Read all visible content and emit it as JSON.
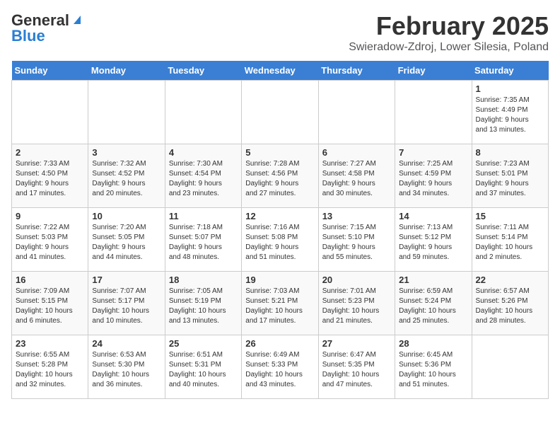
{
  "header": {
    "logo_general": "General",
    "logo_blue": "Blue",
    "month_title": "February 2025",
    "subtitle": "Swieradow-Zdroj, Lower Silesia, Poland"
  },
  "days_of_week": [
    "Sunday",
    "Monday",
    "Tuesday",
    "Wednesday",
    "Thursday",
    "Friday",
    "Saturday"
  ],
  "weeks": [
    [
      {
        "day": "",
        "info": ""
      },
      {
        "day": "",
        "info": ""
      },
      {
        "day": "",
        "info": ""
      },
      {
        "day": "",
        "info": ""
      },
      {
        "day": "",
        "info": ""
      },
      {
        "day": "",
        "info": ""
      },
      {
        "day": "1",
        "info": "Sunrise: 7:35 AM\nSunset: 4:49 PM\nDaylight: 9 hours\nand 13 minutes."
      }
    ],
    [
      {
        "day": "2",
        "info": "Sunrise: 7:33 AM\nSunset: 4:50 PM\nDaylight: 9 hours\nand 17 minutes."
      },
      {
        "day": "3",
        "info": "Sunrise: 7:32 AM\nSunset: 4:52 PM\nDaylight: 9 hours\nand 20 minutes."
      },
      {
        "day": "4",
        "info": "Sunrise: 7:30 AM\nSunset: 4:54 PM\nDaylight: 9 hours\nand 23 minutes."
      },
      {
        "day": "5",
        "info": "Sunrise: 7:28 AM\nSunset: 4:56 PM\nDaylight: 9 hours\nand 27 minutes."
      },
      {
        "day": "6",
        "info": "Sunrise: 7:27 AM\nSunset: 4:58 PM\nDaylight: 9 hours\nand 30 minutes."
      },
      {
        "day": "7",
        "info": "Sunrise: 7:25 AM\nSunset: 4:59 PM\nDaylight: 9 hours\nand 34 minutes."
      },
      {
        "day": "8",
        "info": "Sunrise: 7:23 AM\nSunset: 5:01 PM\nDaylight: 9 hours\nand 37 minutes."
      }
    ],
    [
      {
        "day": "9",
        "info": "Sunrise: 7:22 AM\nSunset: 5:03 PM\nDaylight: 9 hours\nand 41 minutes."
      },
      {
        "day": "10",
        "info": "Sunrise: 7:20 AM\nSunset: 5:05 PM\nDaylight: 9 hours\nand 44 minutes."
      },
      {
        "day": "11",
        "info": "Sunrise: 7:18 AM\nSunset: 5:07 PM\nDaylight: 9 hours\nand 48 minutes."
      },
      {
        "day": "12",
        "info": "Sunrise: 7:16 AM\nSunset: 5:08 PM\nDaylight: 9 hours\nand 51 minutes."
      },
      {
        "day": "13",
        "info": "Sunrise: 7:15 AM\nSunset: 5:10 PM\nDaylight: 9 hours\nand 55 minutes."
      },
      {
        "day": "14",
        "info": "Sunrise: 7:13 AM\nSunset: 5:12 PM\nDaylight: 9 hours\nand 59 minutes."
      },
      {
        "day": "15",
        "info": "Sunrise: 7:11 AM\nSunset: 5:14 PM\nDaylight: 10 hours\nand 2 minutes."
      }
    ],
    [
      {
        "day": "16",
        "info": "Sunrise: 7:09 AM\nSunset: 5:15 PM\nDaylight: 10 hours\nand 6 minutes."
      },
      {
        "day": "17",
        "info": "Sunrise: 7:07 AM\nSunset: 5:17 PM\nDaylight: 10 hours\nand 10 minutes."
      },
      {
        "day": "18",
        "info": "Sunrise: 7:05 AM\nSunset: 5:19 PM\nDaylight: 10 hours\nand 13 minutes."
      },
      {
        "day": "19",
        "info": "Sunrise: 7:03 AM\nSunset: 5:21 PM\nDaylight: 10 hours\nand 17 minutes."
      },
      {
        "day": "20",
        "info": "Sunrise: 7:01 AM\nSunset: 5:23 PM\nDaylight: 10 hours\nand 21 minutes."
      },
      {
        "day": "21",
        "info": "Sunrise: 6:59 AM\nSunset: 5:24 PM\nDaylight: 10 hours\nand 25 minutes."
      },
      {
        "day": "22",
        "info": "Sunrise: 6:57 AM\nSunset: 5:26 PM\nDaylight: 10 hours\nand 28 minutes."
      }
    ],
    [
      {
        "day": "23",
        "info": "Sunrise: 6:55 AM\nSunset: 5:28 PM\nDaylight: 10 hours\nand 32 minutes."
      },
      {
        "day": "24",
        "info": "Sunrise: 6:53 AM\nSunset: 5:30 PM\nDaylight: 10 hours\nand 36 minutes."
      },
      {
        "day": "25",
        "info": "Sunrise: 6:51 AM\nSunset: 5:31 PM\nDaylight: 10 hours\nand 40 minutes."
      },
      {
        "day": "26",
        "info": "Sunrise: 6:49 AM\nSunset: 5:33 PM\nDaylight: 10 hours\nand 43 minutes."
      },
      {
        "day": "27",
        "info": "Sunrise: 6:47 AM\nSunset: 5:35 PM\nDaylight: 10 hours\nand 47 minutes."
      },
      {
        "day": "28",
        "info": "Sunrise: 6:45 AM\nSunset: 5:36 PM\nDaylight: 10 hours\nand 51 minutes."
      },
      {
        "day": "",
        "info": ""
      }
    ]
  ]
}
